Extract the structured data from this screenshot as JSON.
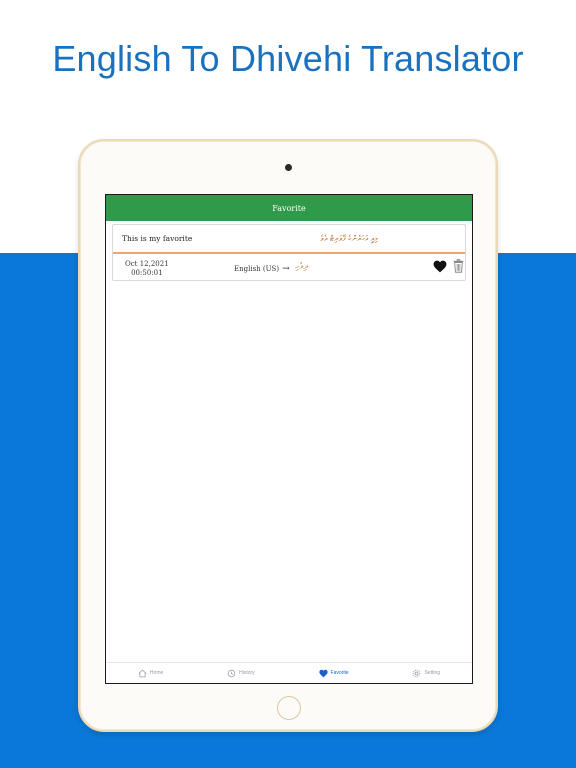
{
  "headline": "English To Dhivehi Translator",
  "app": {
    "title": "Favorite",
    "favorite_item": {
      "source_text": "This is my favorite",
      "translation": "މިއީ އަހަރެންގެ ފޭވަރިޓް އެވެ",
      "date": "Oct 12,2021",
      "time": "00:50:01",
      "language": "English (US)",
      "arrow": "→",
      "target_language": "ދިވެހި"
    },
    "tabs": [
      {
        "label": "Home",
        "icon": "home-icon"
      },
      {
        "label": "History",
        "icon": "history-icon"
      },
      {
        "label": "Favorite",
        "icon": "heart-icon",
        "active": true
      },
      {
        "label": "Setting",
        "icon": "gear-icon"
      }
    ]
  },
  "colors": {
    "band": "#0a78d8",
    "headline": "#1a72bf",
    "app_bar": "#2f9a4a",
    "divider": "#f2a468",
    "active_tab": "#1b62c6"
  }
}
